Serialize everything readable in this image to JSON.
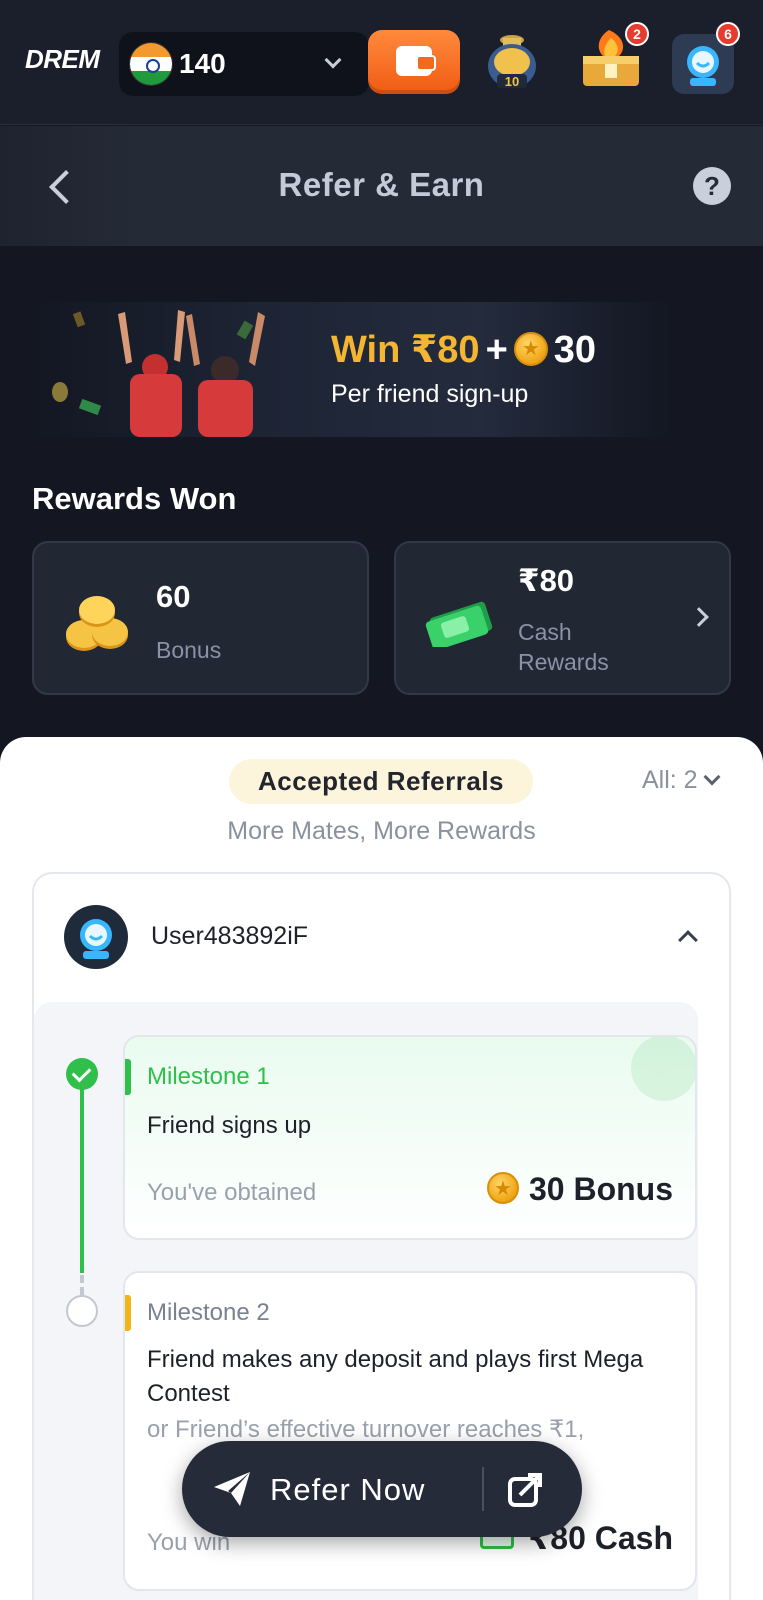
{
  "topbar": {
    "logo": "DREM",
    "balance": "140",
    "jar_count": "10",
    "chest_badge": "2",
    "avatar_badge": "6"
  },
  "header": {
    "title": "Refer & Earn",
    "help_label": "?"
  },
  "promo": {
    "amount": "Win ₹80",
    "plus": "+",
    "coins": "30",
    "subtitle": "Per friend sign-up"
  },
  "rewards": {
    "title": "Rewards Won",
    "bonus_value": "60",
    "bonus_label": "Bonus",
    "cash_value": "₹80",
    "cash_label_1": "Cash",
    "cash_label_2": "Rewards"
  },
  "referrals": {
    "tab_label": "Accepted Referrals",
    "filter_label": "All: 2",
    "subtitle": "More Mates, More Rewards",
    "username": "User483892iF",
    "milestones": [
      {
        "label": "Milestone 1",
        "description": "Friend signs up",
        "status_text": "You've obtained",
        "reward": "30 Bonus"
      },
      {
        "label": "Milestone 2",
        "description": "Friend makes any deposit and plays first Mega Contest",
        "alt_text": "or Friend’s effective turnover reaches ₹1,",
        "status_text": "You win",
        "reward": "₹80 Cash"
      }
    ]
  },
  "actions": {
    "refer_label": "Refer Now"
  },
  "colors": {
    "accent_orange": "#f05b12",
    "accent_gold": "#f4b632",
    "success_green": "#2fbf4a",
    "dark_bg": "#141722"
  }
}
